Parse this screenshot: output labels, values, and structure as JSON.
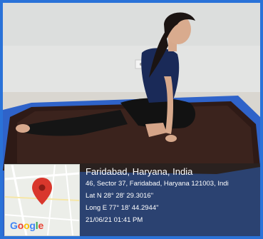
{
  "photo": {
    "subject": "yoga-pose-image"
  },
  "geotag": {
    "city": "Faridabad, Haryana, India",
    "address": "46, Sector 37, Faridabad, Haryana 121003, Indi",
    "latitude": "Lat N 28° 28' 29.3016\"",
    "longitude": "Long E 77° 18' 44.2944\"",
    "timestamp": "21/06/21 01:41 PM"
  },
  "map": {
    "logo_letters": [
      "G",
      "o",
      "o",
      "g",
      "l",
      "e"
    ],
    "pin_color": "#d9372c"
  },
  "colors": {
    "frame": "#2a72d8",
    "overlay": "#282828"
  }
}
